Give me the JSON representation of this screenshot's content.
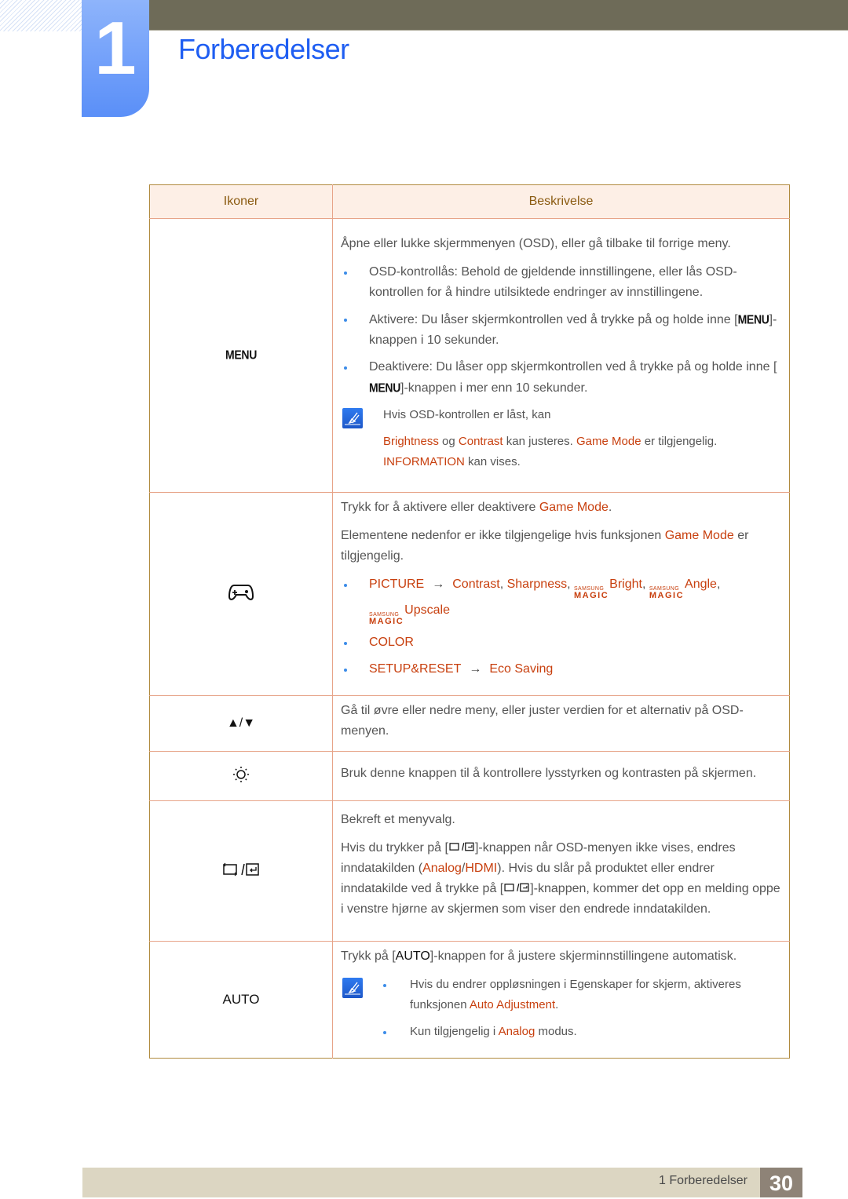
{
  "header": {
    "chapter_number": "1",
    "chapter_title": "Forberedelser"
  },
  "table": {
    "headers": {
      "icons": "Ikoner",
      "description": "Beskrivelse"
    },
    "rows": {
      "menu": {
        "icon_label": "MENU",
        "intro": "Åpne eller lukke skjermmenyen (OSD), eller gå tilbake til forrige meny.",
        "bullets": [
          {
            "text": "OSD-kontrollås: Behold de gjeldende innstillingene, eller lås OSD-kontrollen for å hindre utilsiktede endringer av innstillingene."
          },
          {
            "before": "Aktivere: Du låser skjermkontrollen ved å trykke på og holde inne [",
            "key": "MENU",
            "after": "]-knappen i 10 sekunder."
          },
          {
            "before": "Deaktivere: Du låser opp skjermkontrollen ved å trykke på og holde inne [",
            "key": "MENU",
            "after": "]-knappen i mer enn 10 sekunder."
          }
        ],
        "note": {
          "line1": "Hvis OSD-kontrollen er låst, kan",
          "brightness": "Brightness",
          "og": " og ",
          "contrast": "Contrast",
          "mid": " kan justeres. ",
          "game_mode": "Game Mode",
          "tail": " er tilgjengelig.",
          "information": "INFORMATION",
          "info_tail": " kan vises."
        }
      },
      "game": {
        "icon": "gamepad-icon",
        "p1_before": "Trykk for å aktivere eller deaktivere ",
        "p1_hl": "Game Mode",
        "p1_after": ".",
        "p2_before": "Elementene nedenfor er ikke tilgjengelige hvis funksjonen ",
        "p2_hl": "Game Mode",
        "p2_after": " er tilgjengelig.",
        "magic_top": "SAMSUNG",
        "magic_bottom": "MAGIC",
        "arrow": "→",
        "items": {
          "picture": "PICTURE",
          "contrast": "Contrast",
          "sharpness": "Sharpness",
          "bright": "Bright",
          "angle": "Angle",
          "upscale": "Upscale",
          "color": "COLOR",
          "setup": "SETUP&RESET",
          "eco": "Eco Saving"
        },
        "comma": ", "
      },
      "updown": {
        "icon_label": "▲/▼",
        "text": "Gå til øvre eller nedre meny, eller juster verdien for et alternativ på OSD-menyen."
      },
      "brightness": {
        "icon": "brightness-sun-icon",
        "text": "Bruk denne knappen til å kontrollere lysstyrken og kontrasten på skjermen."
      },
      "source": {
        "icon": "source-enter-icon",
        "p1": "Bekreft et menyvalg.",
        "p2_before": "Hvis du trykker på [",
        "p2_mid": "]-knappen når OSD-menyen ikke vises, endres inndatakilden (",
        "analog": "Analog",
        "slash": "/",
        "hdmi": "HDMI",
        "p2_mid2": "). Hvis du slår på produktet eller endrer inndatakilde ved å trykke på [",
        "p2_after": "]-knappen, kommer det opp en melding oppe i venstre hjørne av skjermen som viser den endrede inndatakilden."
      },
      "auto": {
        "icon_label": "AUTO",
        "p1_before": "Trykk på [",
        "p1_key": "AUTO",
        "p1_after": "]-knappen for å justere skjerminnstillingene automatisk.",
        "note_b1_before": "Hvis du endrer oppløsningen i Egenskaper for skjerm, aktiveres funksjonen ",
        "note_b1_hl": "Auto Adjustment",
        "note_b1_after": ".",
        "note_b2_before": "Kun tilgjengelig i ",
        "note_b2_hl": "Analog",
        "note_b2_after": " modus."
      }
    }
  },
  "footer": {
    "section": "1 Forberedelser",
    "page_number": "30"
  },
  "colors": {
    "title_blue": "#1f5ef2",
    "highlight": "#c8400f",
    "header_text": "#8a5a10",
    "table_border": "#b08a3e",
    "row_divider": "#e7a489"
  }
}
